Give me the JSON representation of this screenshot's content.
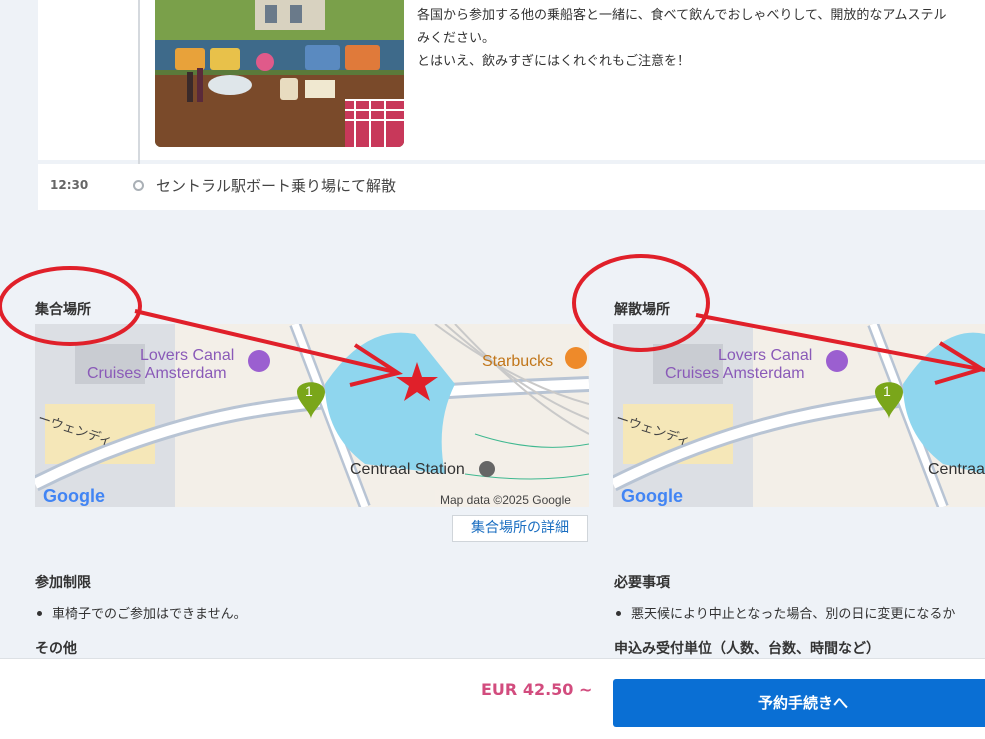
{
  "itinerary": {
    "description_lines": [
      "各国から参加する他の乗船客と一緒に、食べて飲んでおしゃべりして、開放的なアムステル",
      "みください。",
      "とはいえ、飲みすぎにはくれぐれもご注意を！"
    ],
    "end_time": "12:30",
    "end_label": "セントラル駅ボート乗り場にて解散"
  },
  "meeting_point": {
    "title": "集合場所",
    "detail_button": "集合場所の詳細",
    "map": {
      "poi_lovers": [
        "Lovers Canal",
        "Cruises Amsterdam"
      ],
      "poi_starbucks": "Starbucks",
      "station": "Centraal Station",
      "street": "ーウェンディ",
      "marker": "1",
      "logo": "Google",
      "attribution": "Map data ©2025 Google"
    }
  },
  "dropoff_point": {
    "title": "解散場所",
    "map": {
      "poi_lovers": [
        "Lovers Canal",
        "Cruises Amsterdam"
      ],
      "station": "Centraa",
      "street": "ーウェンディ",
      "marker": "1",
      "logo": "Google"
    }
  },
  "restrictions": {
    "title": "参加制限",
    "items": [
      "車椅子でのご参加はできません。"
    ]
  },
  "other": {
    "title": "その他"
  },
  "requirements": {
    "title": "必要事項",
    "items": [
      "悪天候により中止となった場合、別の日に変更になるか"
    ]
  },
  "booking_unit": {
    "title": "申込み受付単位（人数、台数、時間など）"
  },
  "footer": {
    "price": "EUR 42.50 ~",
    "book_button": "予約手続きへ"
  },
  "colors": {
    "accent": "#0a6fd4",
    "price": "#d24c7e",
    "annotation": "#e0202a",
    "water": "#8fd6ee",
    "marker": "#7aa61a"
  }
}
